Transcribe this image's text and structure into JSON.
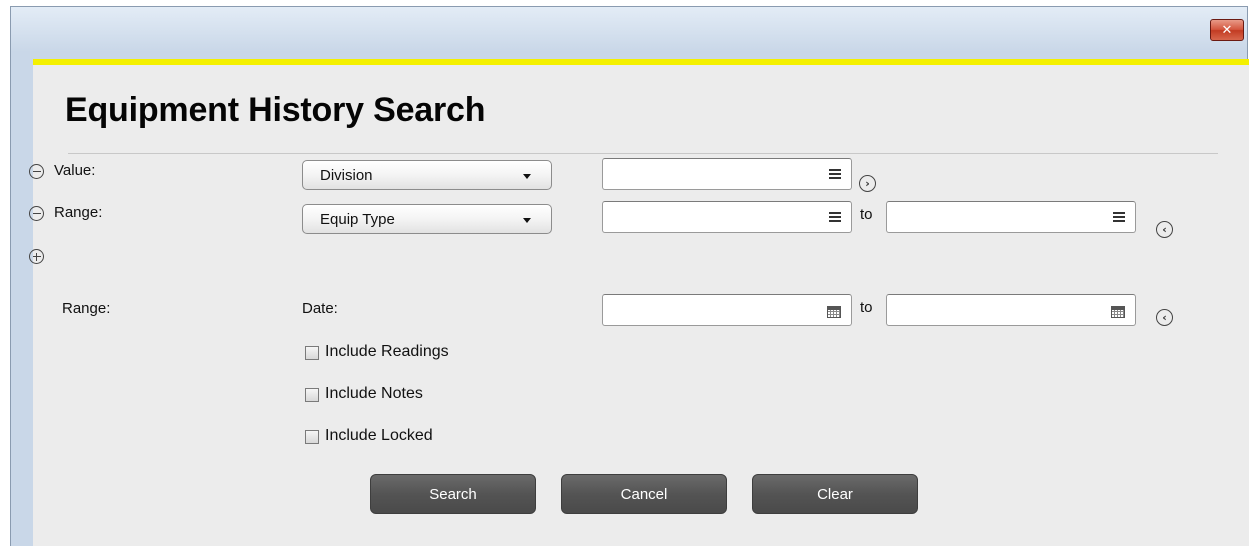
{
  "window": {
    "close_glyph": "✕"
  },
  "title": "Equipment History Search",
  "criteria": [
    {
      "toggle": "remove",
      "label": "Value:",
      "field": "Division",
      "from_value": "",
      "has_to": false
    },
    {
      "toggle": "remove",
      "label": "Range:",
      "field": "Equip Type",
      "from_value": "",
      "has_to": true,
      "to_label": "to",
      "to_value": ""
    }
  ],
  "add_toggle": "add",
  "date_range": {
    "label": "Range:",
    "field_label": "Date:",
    "from_value": "",
    "to_label": "to",
    "to_value": ""
  },
  "options": [
    {
      "label": "Include Readings",
      "checked": false
    },
    {
      "label": "Include Notes",
      "checked": false
    },
    {
      "label": "Include Locked",
      "checked": false
    }
  ],
  "buttons": {
    "search": "Search",
    "cancel": "Cancel",
    "clear": "Clear"
  },
  "colors": {
    "accent_stripe": "#f4f000",
    "button_bg": "#545454",
    "panel_bg": "#ececec"
  }
}
